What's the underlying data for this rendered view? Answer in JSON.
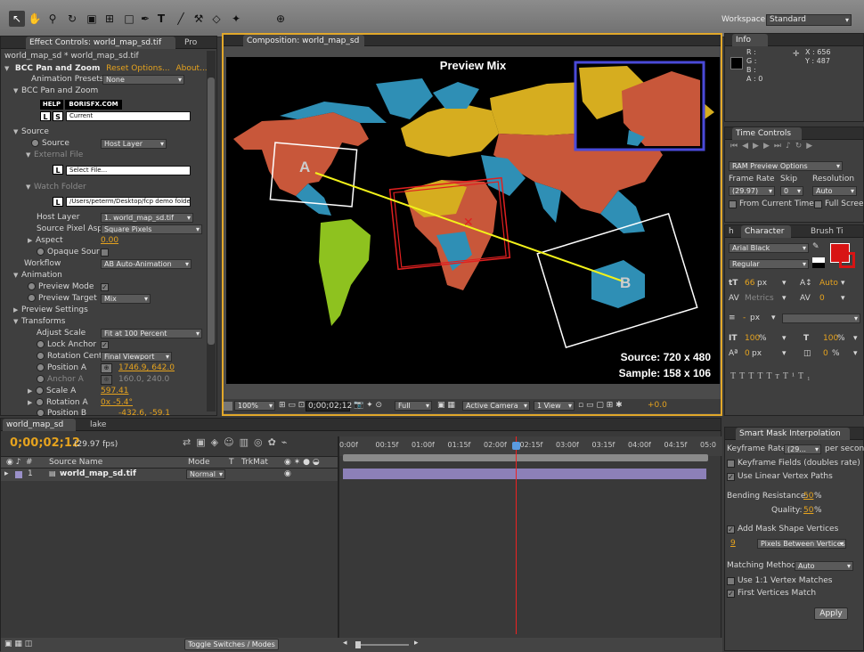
{
  "workspace": {
    "label": "Workspace:",
    "value": "Standard"
  },
  "effect_controls": {
    "tab_label": "Effect Controls: world_map_sd.tif",
    "tab2_label": "Pro",
    "breadcrumb": "world_map_sd * world_map_sd.tif",
    "effect_name": "BCC Pan and Zoom",
    "reset_link": "Reset",
    "options_link": "Options...",
    "about_link": "About...",
    "presets_label": "Animation Presets:",
    "presets_value": "None",
    "section_title": "BCC Pan and Zoom",
    "help_label": "HELP",
    "site_label": "BORISFX.COM",
    "l_label": "L",
    "s_label": "S",
    "current_label": "Current",
    "source_group": "Source",
    "source_label": "Source",
    "source_value": "Host Layer",
    "external_file": "External File",
    "select_file": "Select File...",
    "watch_folder": "Watch Folder",
    "folder_path": "/Users/peterm/Desktop/fcp demo folder",
    "host_layer_label": "Host Layer",
    "host_layer_value": "1. world_map_sd.tif",
    "pixel_asp_label": "Source Pixel Asp",
    "pixel_asp_value": "Square Pixels",
    "aspect_label": "Aspect",
    "aspect_value": "0.00",
    "opaque_label": "Opaque Sour",
    "workflow_label": "Workflow",
    "workflow_value": "AB Auto-Animation",
    "animation_label": "Animation",
    "preview_mode_label": "Preview Mode",
    "preview_target_label": "Preview Target",
    "preview_target_value": "Mix",
    "preview_settings_label": "Preview Settings",
    "transforms_label": "Transforms",
    "adjust_scale_label": "Adjust Scale",
    "adjust_scale_value": "Fit at 100 Percent",
    "lock_anchor_label": "Lock Anchor",
    "rotation_center_label": "Rotation Cent",
    "rotation_center_value": "Final Viewport",
    "position_a_label": "Position A",
    "position_a_value": "1746.9, 642.0",
    "anchor_a_label": "Anchor A",
    "anchor_a_value": "160.0, 240.0",
    "scale_a_label": "Scale A",
    "scale_a_value": "597.41",
    "rotation_a_label": "Rotation A",
    "rotation_a_value": "0x -5.4°",
    "position_b_label": "Position B",
    "position_b_value": "-432.6, -59.1"
  },
  "composition": {
    "tab_label": "Composition: world_map_sd",
    "preview_title": "Preview Mix",
    "label_a": "A",
    "label_b": "B",
    "source_info": "Source:  720 x 480",
    "sample_info": "Sample:  158 x 106",
    "zoom": "100%",
    "timecode": "0;00;02;12",
    "resolution": "Full",
    "camera": "Active Camera",
    "views": "1 View",
    "exposure": "+0.0"
  },
  "info_panel": {
    "tab_label": "Info",
    "r_label": "R :",
    "g_label": "G :",
    "b_label": "B :",
    "a_label": "A : 0",
    "x_label": "X : 656",
    "y_label": "Y : 487"
  },
  "time_controls": {
    "tab_label": "Time Controls",
    "ram_preview": "RAM Preview Options",
    "frame_rate_label": "Frame Rate",
    "skip_label": "Skip",
    "resolution_label": "Resolution",
    "frame_rate_value": "(29.97)",
    "skip_value": "0",
    "resolution_value": "Auto",
    "from_current": "From Current Time",
    "full_screen": "Full Screen"
  },
  "character": {
    "tab_label": "Character",
    "tab2_label": "Brush Ti",
    "tab0_label": "h",
    "font": "Arial Black",
    "style": "Regular",
    "size": "66",
    "size_unit": "px",
    "leading": "Auto",
    "kerning": "Metrics",
    "tracking": "0",
    "stroke_width": "-",
    "stroke_unit": "px",
    "vscale": "100",
    "hscale": "100",
    "pct": "%",
    "baseline": "0",
    "baseline_unit": "px",
    "tsume": "0",
    "fill_color": "#d81414"
  },
  "timeline": {
    "tab_label": "world_map_sd",
    "tab2_label": "lake",
    "current_time": "0;00;02;12",
    "fps": "(29.97 fps)",
    "col_num": "#",
    "col_source": "Source Name",
    "col_mode": "Mode",
    "col_t": "T",
    "col_trkmat": "TrkMat",
    "layer_num": "1",
    "layer_name": "world_map_sd.tif",
    "layer_mode": "Normal",
    "toggle_label": "Toggle Switches / Modes",
    "ruler": [
      "0:00f",
      "00:15f",
      "01:00f",
      "01:15f",
      "02:00f",
      "02:15f",
      "03:00f",
      "03:15f",
      "04:00f",
      "04:15f",
      "05:0"
    ]
  },
  "smart_mask": {
    "tab_label": "Smart Mask Interpolation",
    "keyframe_rate_label": "Keyframe Rate:",
    "keyframe_rate_value": "(29...",
    "per_second": "per second",
    "keyframe_fields": "Keyframe Fields (doubles rate)",
    "linear_vertex": "Use Linear Vertex Paths",
    "bending_label": "Bending Resistance:",
    "bending_value": "50",
    "quality_label": "Quality:",
    "quality_value": "50",
    "pct": "%",
    "add_mask": "Add Mask Shape Vertices",
    "vertices_value": "9",
    "vertices_mode": "Pixels Between Vertices",
    "matching_label": "Matching Method:",
    "matching_value": "Auto",
    "one_to_one": "Use 1:1 Vertex Matches",
    "first_vertices": "First Vertices Match",
    "apply_label": "Apply"
  },
  "colors": {
    "accent": "#e6a31e",
    "timeline_bar": "#8c80b8",
    "map_orange": "#c8573a",
    "map_blue": "#2f8fb5",
    "map_yellow": "#d6ad1f",
    "map_green": "#8ec21f",
    "preview_box": "#4a4ad8"
  }
}
